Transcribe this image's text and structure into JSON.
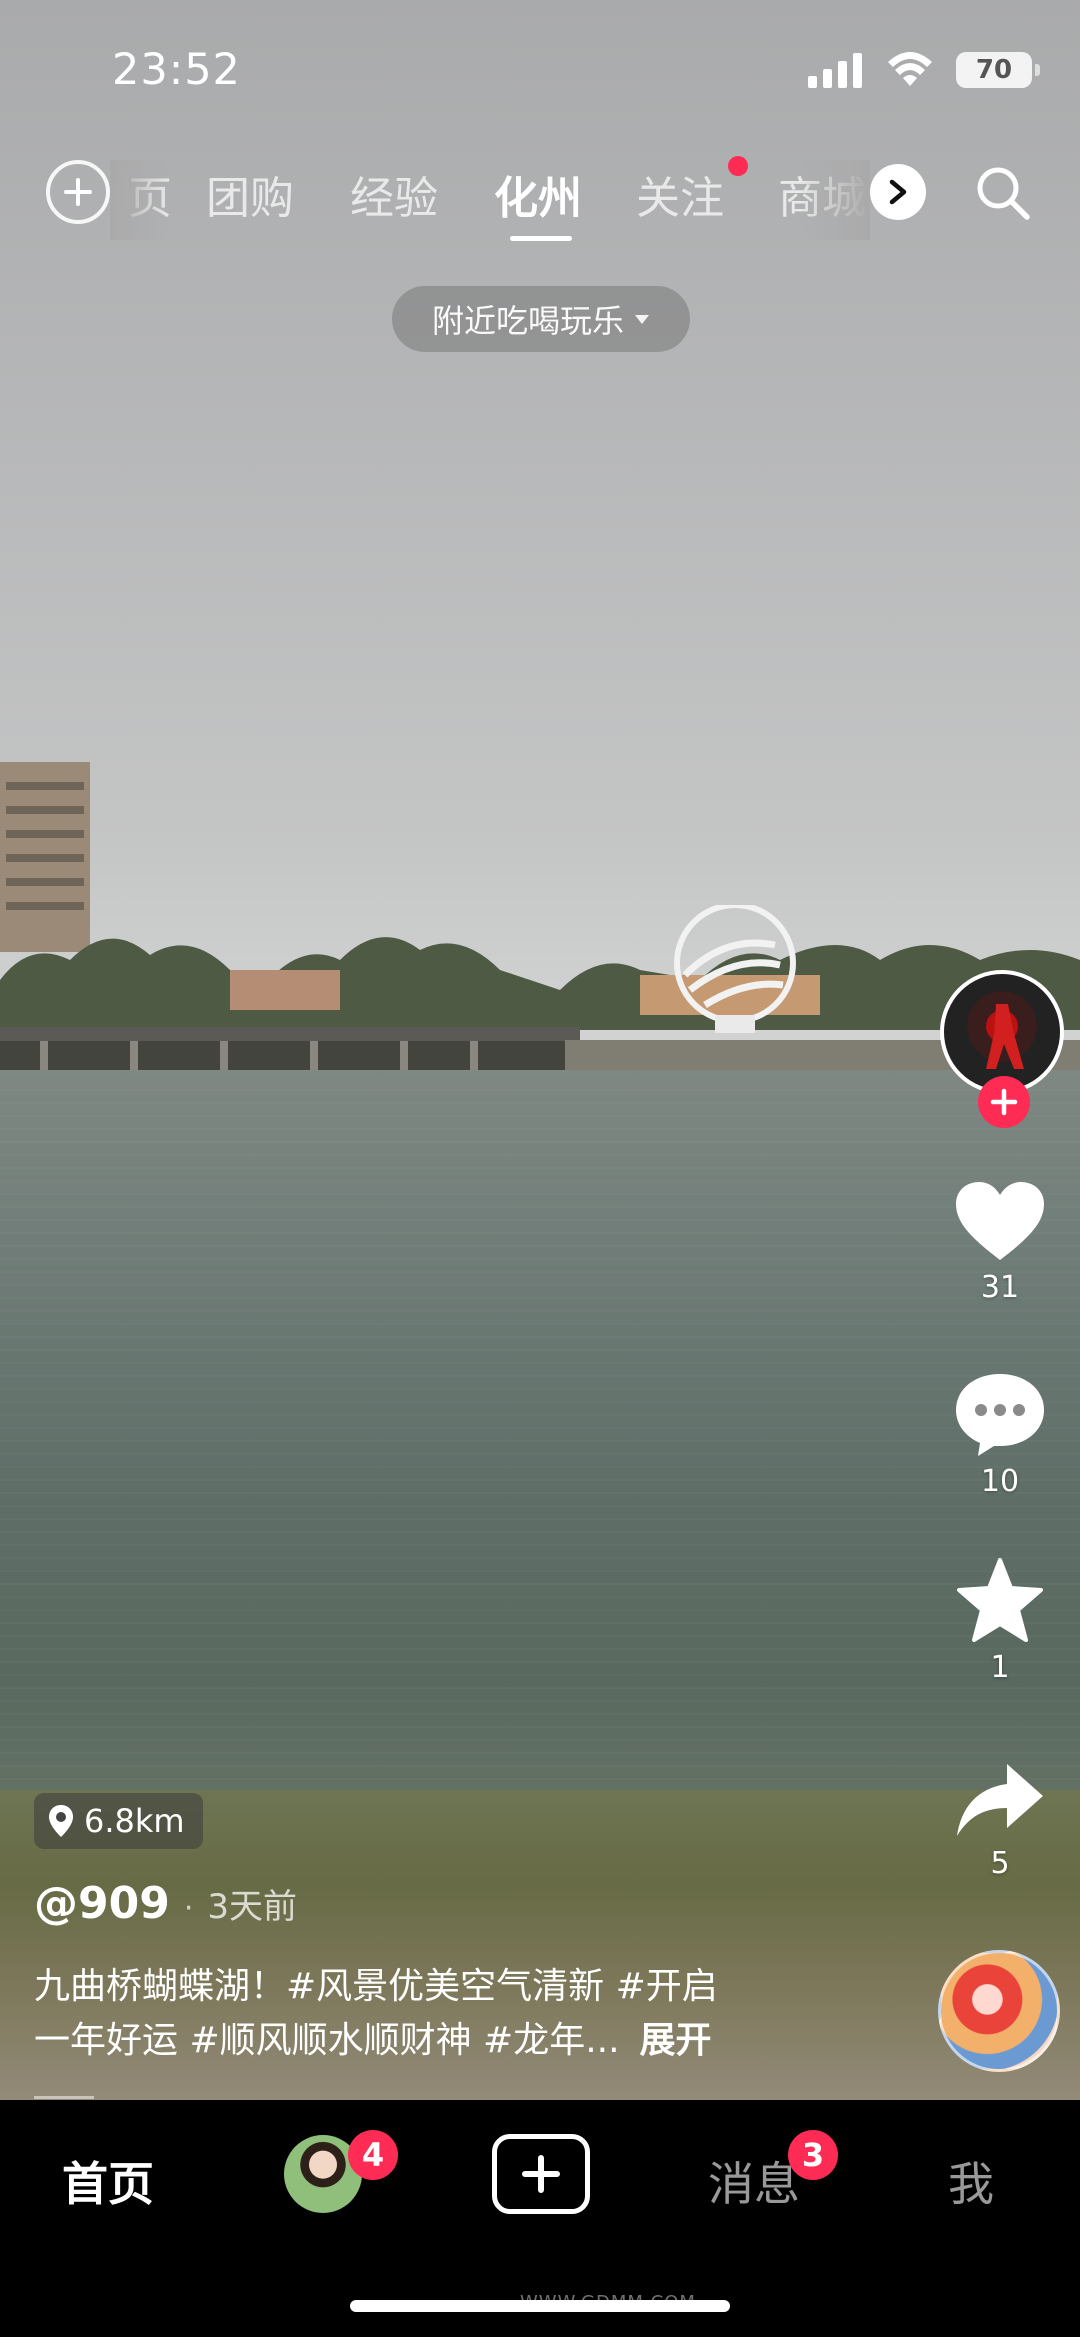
{
  "status_bar": {
    "time": "23:52",
    "battery": "70"
  },
  "top_nav": {
    "tabs": [
      {
        "label": "页",
        "active": false
      },
      {
        "label": "团购",
        "active": false
      },
      {
        "label": "经验",
        "active": false
      },
      {
        "label": "化州",
        "active": true
      },
      {
        "label": "关注",
        "active": false,
        "dot": true
      },
      {
        "label": "商城",
        "active": false
      }
    ]
  },
  "filter_pill": {
    "label": "附近吃喝玩乐"
  },
  "actions": {
    "likes": "31",
    "comments": "10",
    "favorites": "1",
    "shares": "5"
  },
  "post": {
    "distance": "6.8km",
    "author": "@909",
    "time_ago": "3天前",
    "caption_line1": "九曲桥蝴蝶湖！#风景优美空气清新 #开启",
    "caption_line2": "一年好运 #顺风顺水顺财神 #龙年...",
    "expand_label": "展开"
  },
  "bottom_nav": {
    "home": "首页",
    "friends_badge": "4",
    "messages": "消息",
    "messages_badge": "3",
    "me": "我"
  },
  "watermark": "WWW.GDMM.COM",
  "colors": {
    "accent": "#fe2c55",
    "tab_bar": "#000000"
  }
}
